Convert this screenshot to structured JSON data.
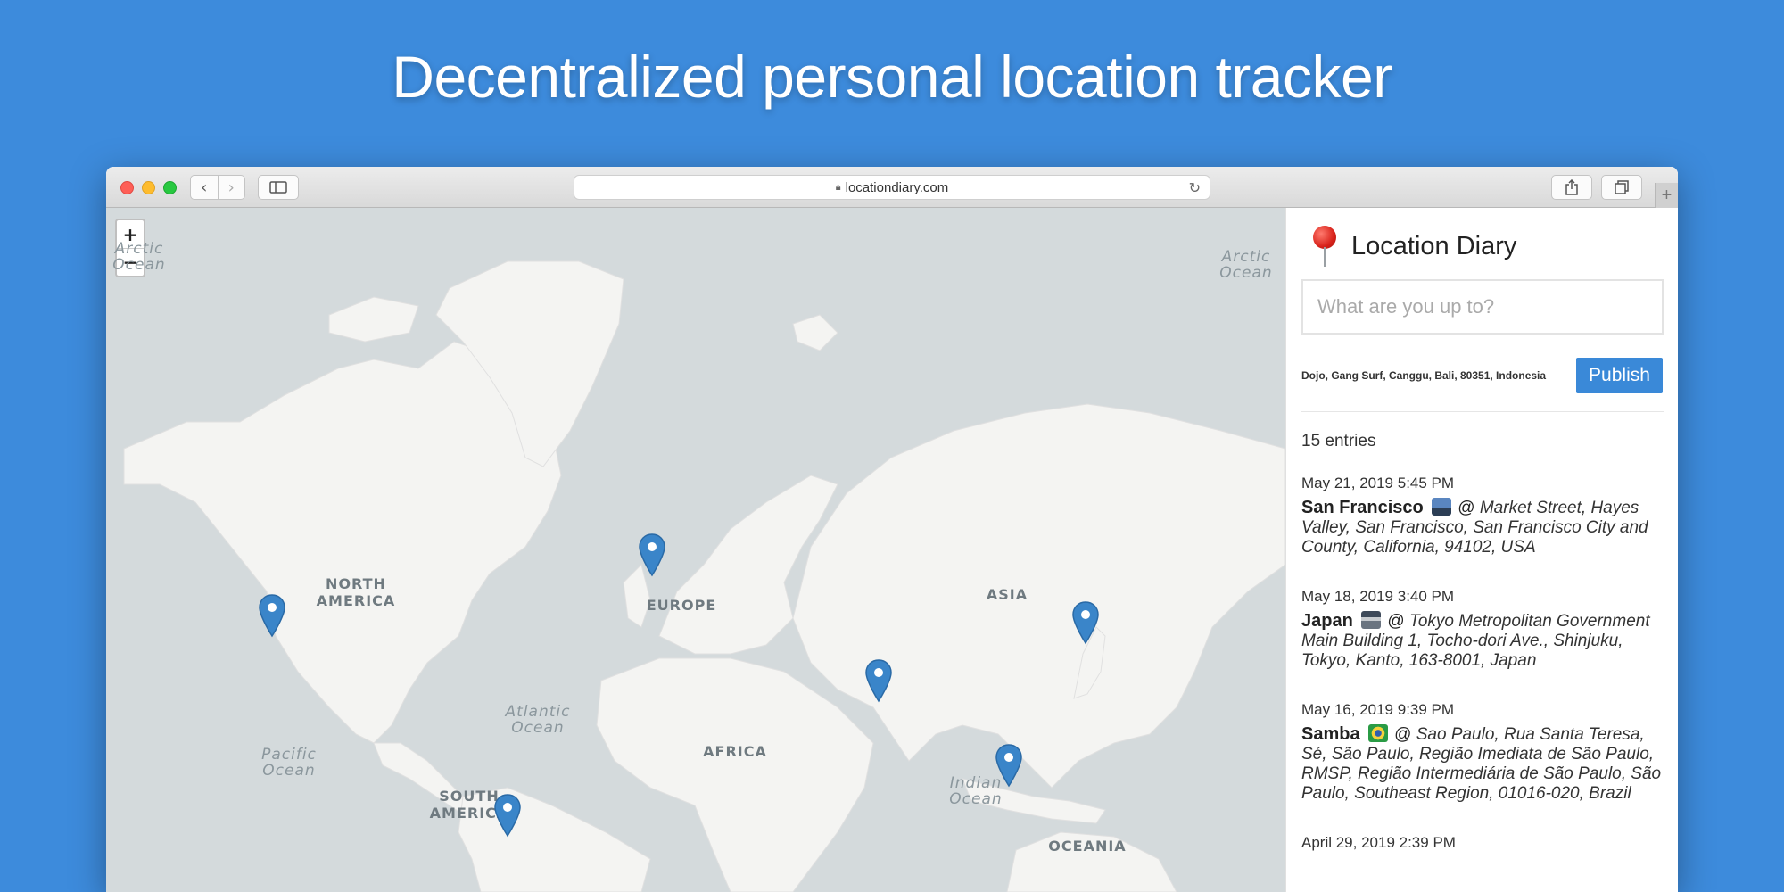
{
  "headline": "Decentralized personal location tracker",
  "browser": {
    "url": "locationdiary.com",
    "icons": [
      "back-icon",
      "forward-icon",
      "sidebar-icon",
      "lock-icon",
      "reload-icon",
      "share-icon",
      "tabs-icon",
      "new-tab-icon"
    ]
  },
  "map": {
    "zoom_in": "+",
    "zoom_out": "−",
    "labels": {
      "north_america": [
        "NORTH",
        "AMERICA"
      ],
      "south_america": [
        "SOUTH",
        "AMERICA"
      ],
      "europe": "EUROPE",
      "africa": "AFRICA",
      "asia": "ASIA",
      "oceania": "OCEANIA",
      "arctic_ocean": [
        "Arctic",
        "Ocean"
      ],
      "arctic_ocean_left": [
        "Arctic",
        "Ocean"
      ],
      "atlantic_ocean": [
        "Atlantic",
        "Ocean"
      ],
      "pacific_ocean": [
        "Pacific",
        "Ocean"
      ],
      "indian_ocean": [
        "Indian",
        "Ocean"
      ]
    },
    "marker_color": "#3a85c9",
    "markers": [
      "San Francisco",
      "London",
      "Japan",
      "India",
      "Indonesia",
      "Sao Paulo"
    ]
  },
  "sidebar": {
    "title": "Location Diary",
    "placeholder": "What are you up to?",
    "current_location": "Dojo, Gang Surf, Canggu, Bali, 80351, Indonesia",
    "publish_label": "Publish",
    "entry_count": "15 entries",
    "accent": "#3a89d8",
    "entries": [
      {
        "date": "May 21, 2019 5:45 PM",
        "place": "San Francisco",
        "emoji": "tram-icon",
        "separator": "@",
        "address": "Market Street, Hayes Valley, San Francisco, San Francisco City and County, California, 94102, USA"
      },
      {
        "date": "May 18, 2019 3:40 PM",
        "place": "Japan",
        "emoji": "japanese-castle-icon",
        "separator": "@",
        "address": "Tokyo Metropolitan Government Main Building 1, Tocho-dori Ave., Shinjuku, Tokyo, Kanto, 163-8001, Japan"
      },
      {
        "date": "May 16, 2019 9:39 PM",
        "place": "Samba",
        "emoji": "brazil-flag-icon",
        "separator": "@",
        "address": "Sao Paulo, Rua Santa Teresa, Sé, São Paulo, Região Imediata de São Paulo, RMSP, Região Intermediária de São Paulo, São Paulo, Southeast Region, 01016-020, Brazil"
      },
      {
        "date": "April 29, 2019 2:39 PM"
      }
    ]
  }
}
